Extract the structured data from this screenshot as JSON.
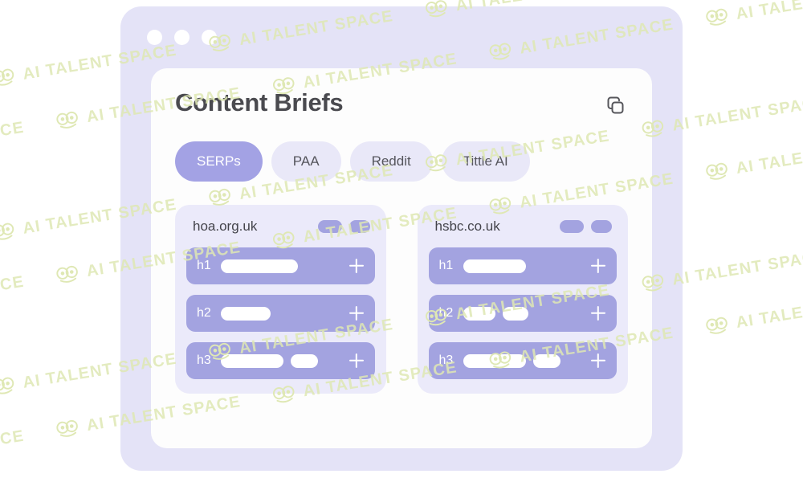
{
  "watermark": {
    "text": "AI TALENT SPACE",
    "logo_icon": "ai-talent-space-logo-icon",
    "color": "#dfe8b4"
  },
  "window": {
    "frame_color": "#e4e3f7",
    "panel_color": "#fdfdfd",
    "traffic_lights": [
      "dot-1",
      "dot-2",
      "dot-3"
    ]
  },
  "header": {
    "title": "Content Briefs",
    "copy_icon": "copy-icon"
  },
  "tabs": [
    {
      "label": "SERPs",
      "active": true
    },
    {
      "label": "PAA",
      "active": false
    },
    {
      "label": "Reddit",
      "active": false
    },
    {
      "label": "Tittle AI",
      "active": false
    }
  ],
  "colors": {
    "accent": "#a3a2e4",
    "row": "#a3a3e0",
    "card_bg": "#ebeafa",
    "tab_bg": "#e9e8f8",
    "title_text": "#4a4a4f"
  },
  "cards": [
    {
      "domain": "hoa.org.uk",
      "badges": [
        "wide",
        "narrow"
      ],
      "rows": [
        {
          "tag": "h1",
          "bars": [
            96
          ],
          "add_icon": "plus-icon"
        },
        {
          "tag": "h2",
          "bars": [
            62
          ],
          "add_icon": "plus-icon"
        },
        {
          "tag": "h3",
          "bars": [
            78,
            34
          ],
          "add_icon": "plus-icon"
        }
      ]
    },
    {
      "domain": "hsbc.co.uk",
      "badges": [
        "wide",
        "narrow"
      ],
      "rows": [
        {
          "tag": "h1",
          "bars": [
            78
          ],
          "add_icon": "plus-icon"
        },
        {
          "tag": "h2",
          "bars": [
            40,
            32
          ],
          "add_icon": "plus-icon"
        },
        {
          "tag": "h3",
          "bars": [
            78,
            34
          ],
          "add_icon": "plus-icon"
        }
      ]
    }
  ]
}
